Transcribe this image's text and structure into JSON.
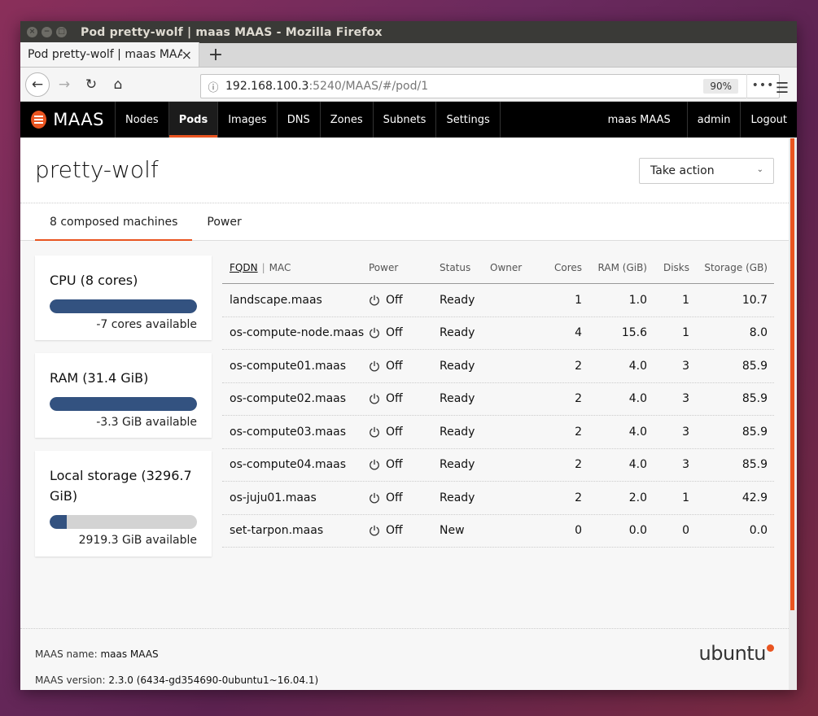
{
  "window": {
    "title": "Pod pretty-wolf | maas MAAS - Mozilla Firefox",
    "controls": [
      "×",
      "−",
      "□"
    ]
  },
  "browser": {
    "tab_label": "Pod pretty-wolf | maas MAAS",
    "tab_close": "×",
    "new_tab": "+",
    "url_host": "192.168.100.3",
    "url_path": ":5240/MAAS/#/pod/1",
    "zoom": "90%",
    "page_actions": "•••",
    "menu": "☰",
    "back": "←",
    "forward": "→",
    "reload": "↻",
    "home": "⌂",
    "info": "ⓘ"
  },
  "appnav": {
    "logo": "MAAS",
    "items": [
      "Nodes",
      "Pods",
      "Images",
      "DNS",
      "Zones",
      "Subnets",
      "Settings"
    ],
    "active": "Pods",
    "right": [
      "maas MAAS",
      "admin",
      "Logout"
    ]
  },
  "page": {
    "title": "pretty-wolf",
    "take_action": "Take action",
    "tabs": [
      "8 composed machines",
      "Power"
    ]
  },
  "cards": [
    {
      "title": "CPU (8 cores)",
      "available": "-7 cores available",
      "used_fraction": 1.0
    },
    {
      "title": "RAM (31.4 GiB)",
      "available": "-3.3 GiB available",
      "used_fraction": 1.0
    },
    {
      "title": "Local storage (3296.7 GiB)",
      "available": "2919.3 GiB available",
      "used_fraction": 0.114
    }
  ],
  "table": {
    "headers": {
      "fqdn": "FQDN",
      "sep": "|",
      "mac": "MAC",
      "power": "Power",
      "status": "Status",
      "owner": "Owner",
      "cores": "Cores",
      "ram": "RAM (GiB)",
      "disks": "Disks",
      "storage": "Storage (GB)"
    },
    "rows": [
      {
        "fqdn": "landscape.maas",
        "power": "Off",
        "status": "Ready",
        "owner": "",
        "cores": "1",
        "ram": "1.0",
        "disks": "1",
        "storage": "10.7"
      },
      {
        "fqdn": "os-compute-node.maas",
        "power": "Off",
        "status": "Ready",
        "owner": "",
        "cores": "4",
        "ram": "15.6",
        "disks": "1",
        "storage": "8.0"
      },
      {
        "fqdn": "os-compute01.maas",
        "power": "Off",
        "status": "Ready",
        "owner": "",
        "cores": "2",
        "ram": "4.0",
        "disks": "3",
        "storage": "85.9"
      },
      {
        "fqdn": "os-compute02.maas",
        "power": "Off",
        "status": "Ready",
        "owner": "",
        "cores": "2",
        "ram": "4.0",
        "disks": "3",
        "storage": "85.9"
      },
      {
        "fqdn": "os-compute03.maas",
        "power": "Off",
        "status": "Ready",
        "owner": "",
        "cores": "2",
        "ram": "4.0",
        "disks": "3",
        "storage": "85.9"
      },
      {
        "fqdn": "os-compute04.maas",
        "power": "Off",
        "status": "Ready",
        "owner": "",
        "cores": "2",
        "ram": "4.0",
        "disks": "3",
        "storage": "85.9"
      },
      {
        "fqdn": "os-juju01.maas",
        "power": "Off",
        "status": "Ready",
        "owner": "",
        "cores": "2",
        "ram": "2.0",
        "disks": "1",
        "storage": "42.9"
      },
      {
        "fqdn": "set-tarpon.maas",
        "power": "Off",
        "status": "New",
        "owner": "",
        "cores": "0",
        "ram": "0.0",
        "disks": "0",
        "storage": "0.0"
      }
    ]
  },
  "footer": {
    "name_label": "MAAS name:",
    "name_value": "maas MAAS",
    "version_label": "MAAS version:",
    "version_value": "2.3.0 (6434-gd354690-0ubuntu1~16.04.1)",
    "brand": "ubuntu"
  },
  "colors": {
    "accent": "#e95420",
    "bar_fill": "#335280"
  }
}
